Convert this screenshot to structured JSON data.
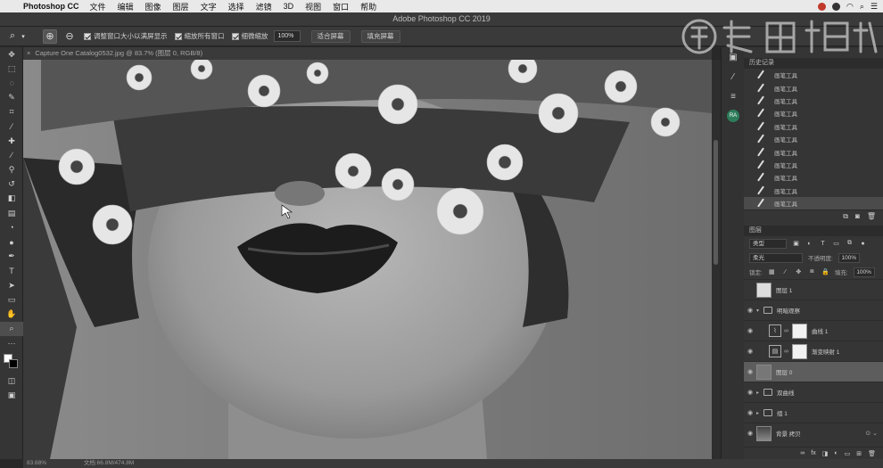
{
  "menubar": {
    "app": "Photoshop CC",
    "items": [
      "文件",
      "编辑",
      "图像",
      "图层",
      "文字",
      "选择",
      "滤镜",
      "3D",
      "视图",
      "窗口",
      "帮助"
    ]
  },
  "window": {
    "title": "Adobe Photoshop CC 2019"
  },
  "options": {
    "checkbox1": "调整窗口大小以满屏显示",
    "checkbox2": "缩放所有窗口",
    "checkbox3": "细微缩放",
    "zoom_value": "100%",
    "fit_screen": "适合屏幕",
    "fill_screen": "填充屏幕"
  },
  "document": {
    "tab": "Capture One Catalog0532.jpg @ 83.7% (图层 0, RGB/8)"
  },
  "status": {
    "zoom": "83.68%",
    "docsize": "文档:66.8M/474.8M"
  },
  "history": {
    "header": "历史记录",
    "items": [
      "画笔工具",
      "画笔工具",
      "画笔工具",
      "画笔工具",
      "画笔工具",
      "画笔工具",
      "画笔工具",
      "画笔工具",
      "画笔工具",
      "画笔工具",
      "画笔工具"
    ],
    "selected_index": 10
  },
  "layers": {
    "header": "图层",
    "kind_label": "类型",
    "blend_mode": "柔光",
    "opacity_label": "不透明度:",
    "opacity_value": "100%",
    "lock_label": "锁定:",
    "fill_label": "填充:",
    "fill_value": "100%",
    "list": [
      {
        "name": "图层 1",
        "type": "pixel"
      },
      {
        "name": "明暗观察",
        "type": "group",
        "open": true
      },
      {
        "name": "曲线 1",
        "type": "curves"
      },
      {
        "name": "渐变映射 1",
        "type": "gradient"
      },
      {
        "name": "图层 0",
        "type": "pixel-selected"
      },
      {
        "name": "双曲线",
        "type": "group"
      },
      {
        "name": "组 1",
        "type": "group"
      },
      {
        "name": "背景 拷贝",
        "type": "photo"
      }
    ]
  },
  "panelstrip": {
    "avatar": "RA"
  },
  "colors": {
    "accent": "#2e7d5a",
    "panel": "#353535",
    "canvas_bg": "#777777"
  }
}
